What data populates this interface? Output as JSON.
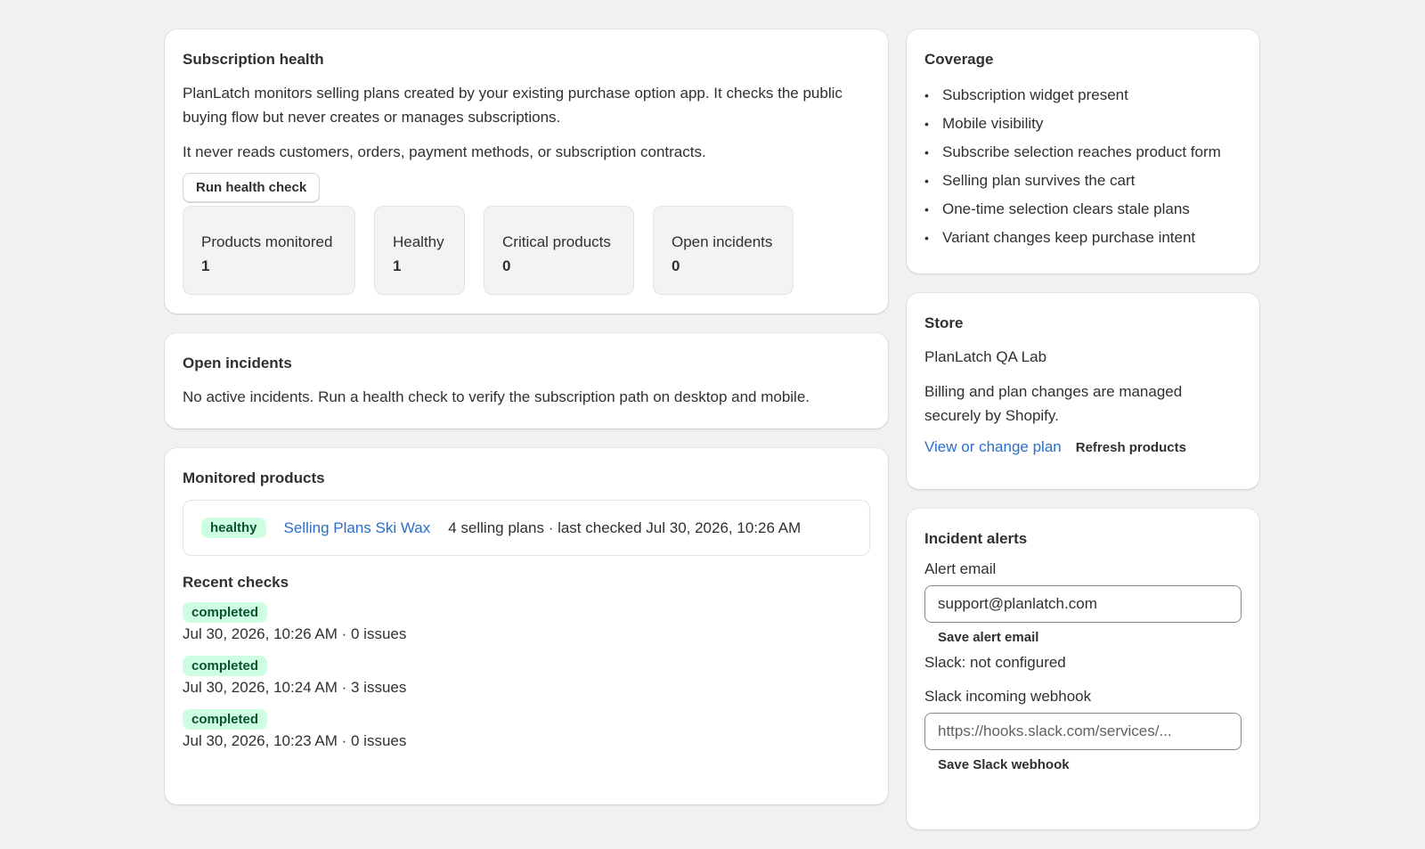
{
  "subscription_health": {
    "title": "Subscription health",
    "desc1": "PlanLatch monitors selling plans created by your existing purchase option app. It checks the public buying flow but never creates or manages subscriptions.",
    "desc2": "It never reads customers, orders, payment methods, or subscription contracts.",
    "run_button": "Run health check",
    "stats": [
      {
        "label": "Products monitored",
        "value": "1"
      },
      {
        "label": "Healthy",
        "value": "1"
      },
      {
        "label": "Critical products",
        "value": "0"
      },
      {
        "label": "Open incidents",
        "value": "0"
      }
    ]
  },
  "open_incidents": {
    "title": "Open incidents",
    "message": "No active incidents. Run a health check to verify the subscription path on desktop and mobile."
  },
  "monitored_products": {
    "title": "Monitored products",
    "products": [
      {
        "status": "healthy",
        "name": "Selling Plans Ski Wax",
        "meta": "4 selling plans · last checked Jul 30, 2026, 10:26 AM"
      }
    ],
    "recent_title": "Recent checks",
    "checks": [
      {
        "status": "completed",
        "meta": "Jul 30, 2026, 10:26 AM · 0 issues"
      },
      {
        "status": "completed",
        "meta": "Jul 30, 2026, 10:24 AM · 3 issues"
      },
      {
        "status": "completed",
        "meta": "Jul 30, 2026, 10:23 AM · 0 issues"
      }
    ]
  },
  "coverage": {
    "title": "Coverage",
    "items": [
      "Subscription widget present",
      "Mobile visibility",
      "Subscribe selection reaches product form",
      "Selling plan survives the cart",
      "One-time selection clears stale plans",
      "Variant changes keep purchase intent"
    ]
  },
  "store": {
    "title": "Store",
    "name": "PlanLatch QA Lab",
    "billing": "Billing and plan changes are managed securely by Shopify.",
    "view_plan": "View or change plan",
    "refresh": "Refresh products"
  },
  "alerts": {
    "title": "Incident alerts",
    "email_label": "Alert email",
    "email_value": "support@planlatch.com",
    "save_email": "Save alert email",
    "slack_status": "Slack: not configured",
    "webhook_label": "Slack incoming webhook",
    "webhook_placeholder": "https://hooks.slack.com/services/...",
    "save_webhook": "Save Slack webhook"
  },
  "colors": {
    "badge_bg": "#cdfee1",
    "badge_text": "#0c5132",
    "link": "#2c6ecb",
    "page_bg": "#f1f1f1"
  }
}
